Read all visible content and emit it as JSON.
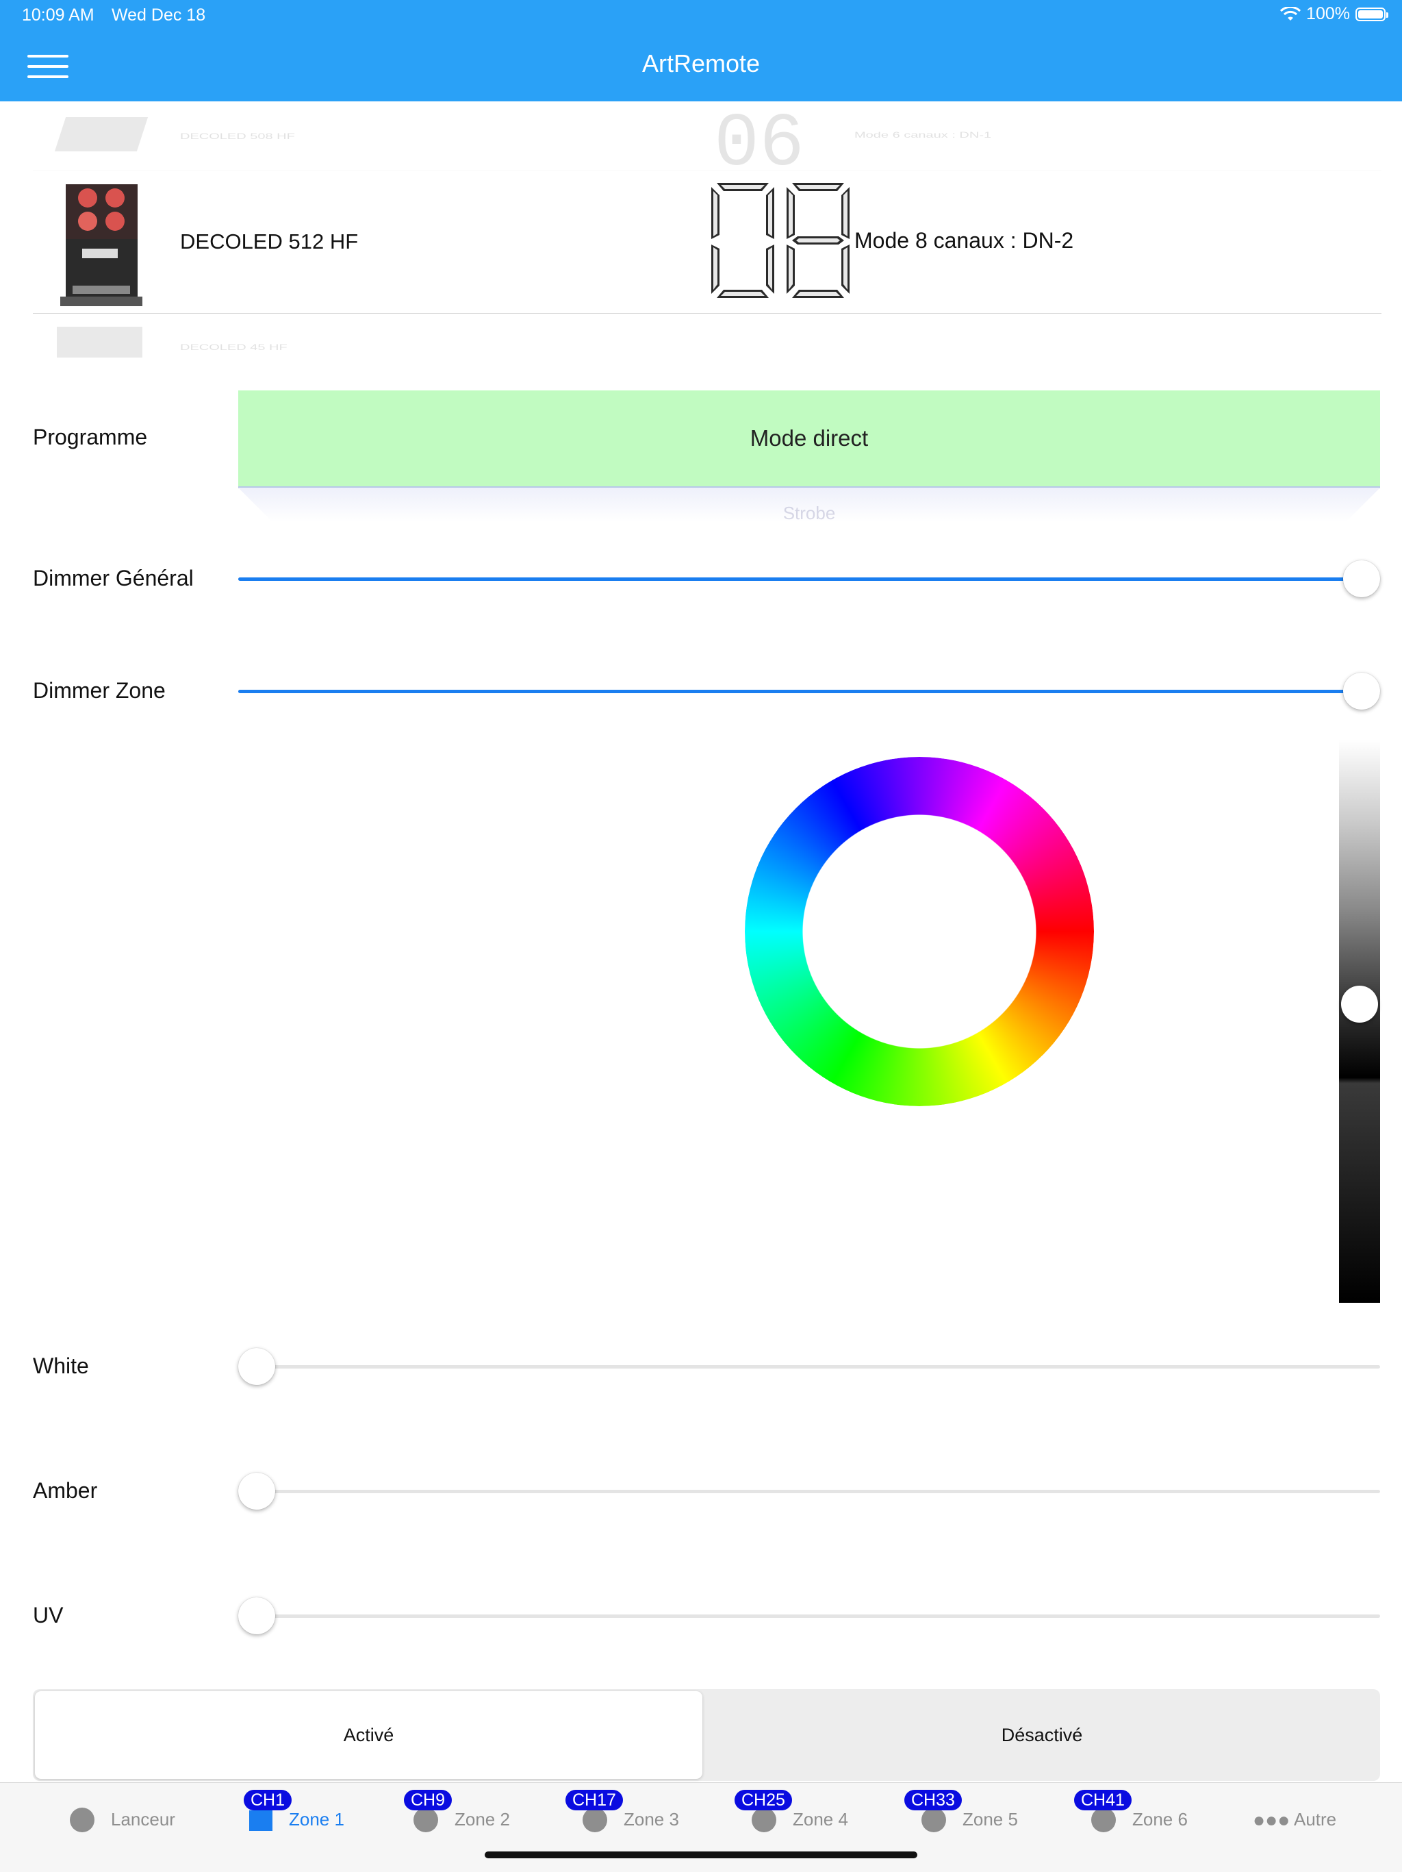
{
  "status_bar": {
    "time": "10:09 AM",
    "date": "Wed Dec 18",
    "battery": "100%"
  },
  "header": {
    "title": "ArtRemote",
    "menu_icon": "hamburger-icon"
  },
  "devices": [
    {
      "name": "DECOLED 508 HF",
      "digits": "06",
      "mode": "Mode 6 canaux : DN-1"
    },
    {
      "name": "DECOLED 512 HF",
      "digits": "08",
      "mode": "Mode 8 canaux : DN-2"
    },
    {
      "name": "DECOLED 45 HF"
    }
  ],
  "programme": {
    "label": "Programme",
    "selected": "Mode direct",
    "next": "Strobe"
  },
  "sliders": [
    {
      "label": "Dimmer Général",
      "value": 1.0
    },
    {
      "label": "Dimmer Zone",
      "value": 1.0
    },
    {
      "label": "White",
      "value": 0.0
    },
    {
      "label": "Amber",
      "value": 0.0
    },
    {
      "label": "UV",
      "value": 0.0
    }
  ],
  "brightness_level": 0.47,
  "toggle": {
    "on_label": "Activé",
    "off_label": "Désactivé",
    "selected": "on"
  },
  "tabs": [
    {
      "label": "Lanceur"
    },
    {
      "label": "Zone 1",
      "badge": "CH1",
      "selected": true
    },
    {
      "label": "Zone 2",
      "badge": "CH9"
    },
    {
      "label": "Zone 3",
      "badge": "CH17"
    },
    {
      "label": "Zone 4",
      "badge": "CH25"
    },
    {
      "label": "Zone 5",
      "badge": "CH33"
    },
    {
      "label": "Zone 6",
      "badge": "CH41"
    },
    {
      "label": "Autre"
    }
  ],
  "colors": {
    "accent": "#2aa1f7",
    "slider_fill": "#1a7ef0",
    "programme_bg": "#c1fbc1",
    "badge": "#0a0ce0"
  }
}
